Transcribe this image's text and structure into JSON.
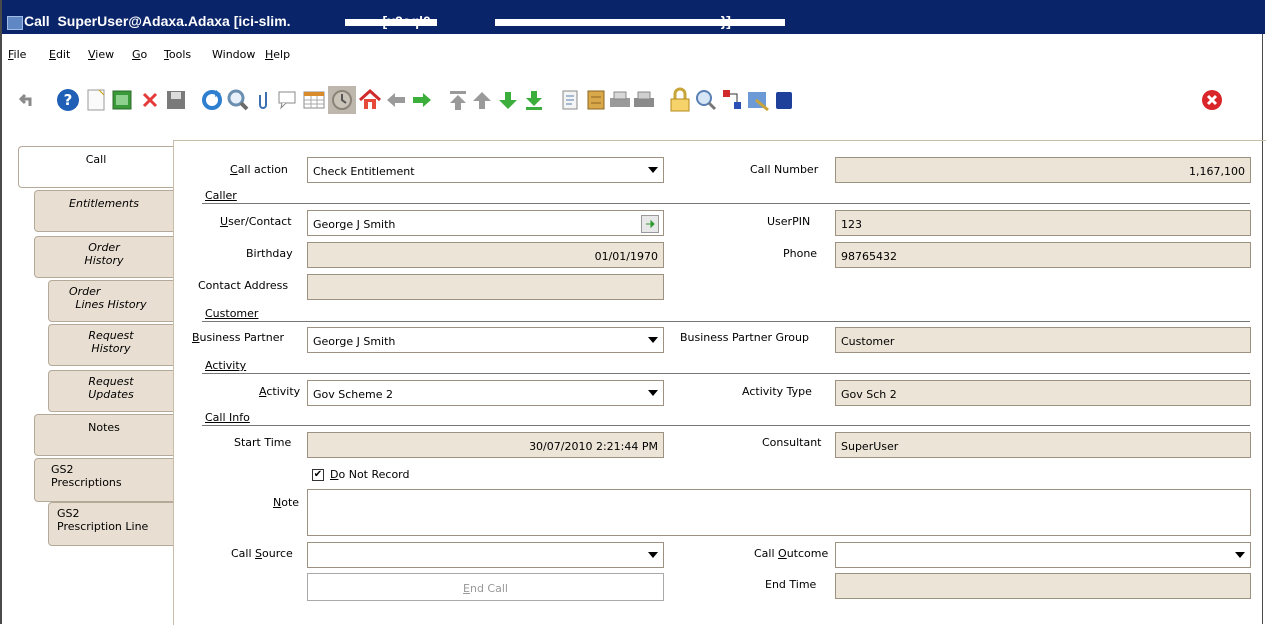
{
  "window": {
    "title_part1": "Call  SuperUser@Adaxa.Adaxa [ici-slim.",
    "title_part2": "[x2sql0",
    "title_part3": "}]"
  },
  "menu": [
    "File",
    "Edit",
    "View",
    "Go",
    "Tools",
    "Window",
    "Help"
  ],
  "menu_mnemonic": [
    "F",
    "E",
    "V",
    "G",
    "T",
    "W",
    "H"
  ],
  "toolbar_icons": [
    "undo-icon",
    "help-icon",
    "new-record-icon",
    "copy-record-icon",
    "delete-icon",
    "save-icon",
    "refresh-icon",
    "find-icon",
    "attachment-icon",
    "chat-icon",
    "grid-toggle-icon",
    "history-icon",
    "home-icon",
    "back-icon",
    "forward-icon",
    "first-record-icon",
    "previous-record-icon",
    "next-record-icon",
    "last-record-icon",
    "report-icon",
    "archive-icon",
    "print-preview-icon",
    "print-icon",
    "lock-icon",
    "zoom-across-icon",
    "workflow-icon",
    "product-info-icon",
    "close-window-icon",
    "exit-icon"
  ],
  "tabs": [
    {
      "line1": "Call",
      "line2": ""
    },
    {
      "line1": "Entitlements",
      "line2": ""
    },
    {
      "line1": "Order",
      "line2": "History"
    },
    {
      "line1": "Order",
      "line2": "Lines History"
    },
    {
      "line1": "Request",
      "line2": "History"
    },
    {
      "line1": "Request",
      "line2": "Updates"
    },
    {
      "line1": "Notes",
      "line2": ""
    },
    {
      "line1": "GS2",
      "line2": "Prescriptions"
    },
    {
      "line1": "GS2",
      "line2": "Prescription Line"
    }
  ],
  "form": {
    "call_action_label": "Call action",
    "call_action_value": "Check Entitlement",
    "call_number_label": "Call Number",
    "call_number_value": "1,167,100",
    "caller_section": "Caller",
    "user_contact_label": "User/Contact",
    "user_contact_value": "George J Smith",
    "userpin_label": "UserPIN",
    "userpin_value": "123",
    "birthday_label": "Birthday",
    "birthday_value": "01/01/1970",
    "phone_label": "Phone",
    "phone_value": "98765432",
    "contact_address_label": "Contact Address",
    "contact_address_value": "",
    "customer_section": "Customer",
    "business_partner_label": "Business Partner",
    "business_partner_value": "George J Smith",
    "bp_group_label": "Business Partner Group",
    "bp_group_value": "Customer",
    "activity_section": "Activity",
    "activity_label": "Activity",
    "activity_value": "Gov Scheme 2",
    "activity_type_label": "Activity Type",
    "activity_type_value": "Gov Sch 2",
    "call_info_section": "Call Info",
    "start_time_label": "Start Time",
    "start_time_value": "30/07/2010 2:21:44 PM",
    "consultant_label": "Consultant",
    "consultant_value": "SuperUser",
    "do_not_record_label": "Do Not Record",
    "do_not_record_checked": "✔",
    "note_label": "Note",
    "note_value": "",
    "call_source_label": "Call Source",
    "call_source_value": "",
    "call_outcome_label": "Call Outcome",
    "call_outcome_value": "",
    "end_call_button": "End Call",
    "end_time_label": "End Time",
    "end_time_value": ""
  }
}
